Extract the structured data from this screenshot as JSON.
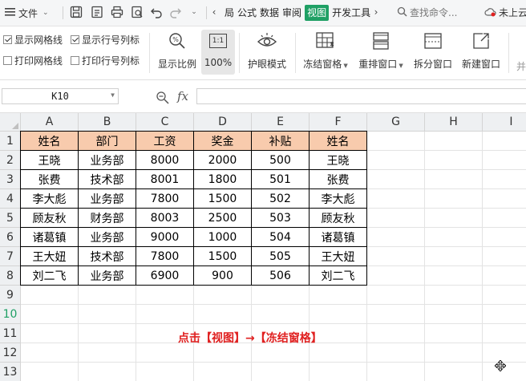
{
  "menubar": {
    "file_label": "文件",
    "tabs": [
      "局",
      "公式",
      "数据",
      "审阅",
      "视图",
      "开发工具"
    ],
    "active_tab": "视图",
    "search_placeholder": "查找命令...",
    "cloud_label": "未上云"
  },
  "ribbon": {
    "show_gridlines": "显示网格线",
    "show_headings": "显示行号列标",
    "print_gridlines": "打印网格线",
    "print_headings": "打印行号列标",
    "zoom_label": "显示比例",
    "zoom_value": "100%",
    "zoom_100_icon_text": "1:1",
    "eye_protection": "护眼模式",
    "freeze_panes": "冻结窗格",
    "arrange_windows": "重排窗口",
    "split_window": "拆分窗口",
    "new_window": "新建窗口",
    "overflow": "并"
  },
  "formula_bar": {
    "cell_ref": "K10",
    "fx": "fx",
    "formula": ""
  },
  "sheet": {
    "columns": [
      "A",
      "B",
      "C",
      "D",
      "E",
      "F",
      "G",
      "H",
      "I"
    ],
    "rows": [
      "1",
      "2",
      "3",
      "4",
      "5",
      "6",
      "7",
      "8",
      "9",
      "10",
      "11",
      "12",
      "13"
    ],
    "active_row": "10",
    "table": [
      [
        "姓名",
        "部门",
        "工资",
        "奖金",
        "补贴",
        "姓名"
      ],
      [
        "王晓",
        "业务部",
        "8000",
        "2000",
        "500",
        "王晓"
      ],
      [
        "张费",
        "技术部",
        "8001",
        "1800",
        "501",
        "张费"
      ],
      [
        "李大彪",
        "业务部",
        "7800",
        "1500",
        "502",
        "李大彪"
      ],
      [
        "顾友秋",
        "财务部",
        "8003",
        "2500",
        "503",
        "顾友秋"
      ],
      [
        "诸葛镇",
        "业务部",
        "9000",
        "1000",
        "504",
        "诸葛镇"
      ],
      [
        "王大妞",
        "技术部",
        "7800",
        "1500",
        "505",
        "王大妞"
      ],
      [
        "刘二飞",
        "业务部",
        "6900",
        "900",
        "506",
        "刘二飞"
      ]
    ],
    "annotation": "点击【视图】→【冻结窗格】"
  },
  "colors": {
    "accent": "#1fa065",
    "header_fill": "#f8cbad",
    "annotation": "#e02020"
  }
}
